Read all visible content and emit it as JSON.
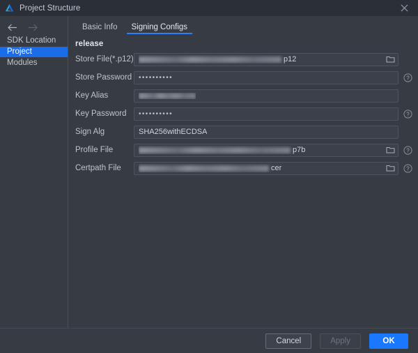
{
  "window": {
    "title": "Project Structure",
    "app_icon": "deveco-logo-icon",
    "close_label": "×"
  },
  "sidebar": {
    "nav": {
      "back_icon": "arrow-left-icon",
      "forward_icon": "arrow-right-icon"
    },
    "items": [
      {
        "label": "SDK Location",
        "selected": false
      },
      {
        "label": "Project",
        "selected": true
      },
      {
        "label": "Modules",
        "selected": false
      }
    ]
  },
  "main": {
    "tabs": [
      {
        "label": "Basic Info",
        "active": false
      },
      {
        "label": "Signing Configs",
        "active": true
      }
    ],
    "section_title": "release",
    "fields": [
      {
        "label": "Store File(*.p12)",
        "value": "",
        "redacted": true,
        "redacted_width": 205,
        "suffix": "p12",
        "browse": true,
        "help": false,
        "password": false
      },
      {
        "label": "Store Password",
        "value": "••••••••••",
        "redacted": false,
        "suffix": "",
        "browse": false,
        "help": true,
        "password": true
      },
      {
        "label": "Key Alias",
        "value": "",
        "redacted": true,
        "redacted_width": 82,
        "suffix": "",
        "browse": false,
        "help": false,
        "password": false
      },
      {
        "label": "Key Password",
        "value": "••••••••••",
        "redacted": false,
        "suffix": "",
        "browse": false,
        "help": true,
        "password": true
      },
      {
        "label": "Sign Alg",
        "value": "SHA256withECDSA",
        "redacted": false,
        "suffix": "",
        "browse": false,
        "help": false,
        "password": false
      },
      {
        "label": "Profile File",
        "value": "",
        "redacted": true,
        "redacted_width": 218,
        "suffix": "p7b",
        "browse": true,
        "help": true,
        "password": false
      },
      {
        "label": "Certpath File",
        "value": "",
        "redacted": true,
        "redacted_width": 187,
        "suffix": "cer",
        "browse": true,
        "help": true,
        "password": false
      }
    ]
  },
  "footer": {
    "cancel_label": "Cancel",
    "apply_label": "Apply",
    "ok_label": "OK"
  },
  "colors": {
    "accent": "#1a78ff",
    "selection": "#1a6ce8",
    "window_bg": "#373b43",
    "titlebar_bg": "#2b2f38",
    "field_bg": "#3b404a",
    "text": "#bfc4cc"
  }
}
